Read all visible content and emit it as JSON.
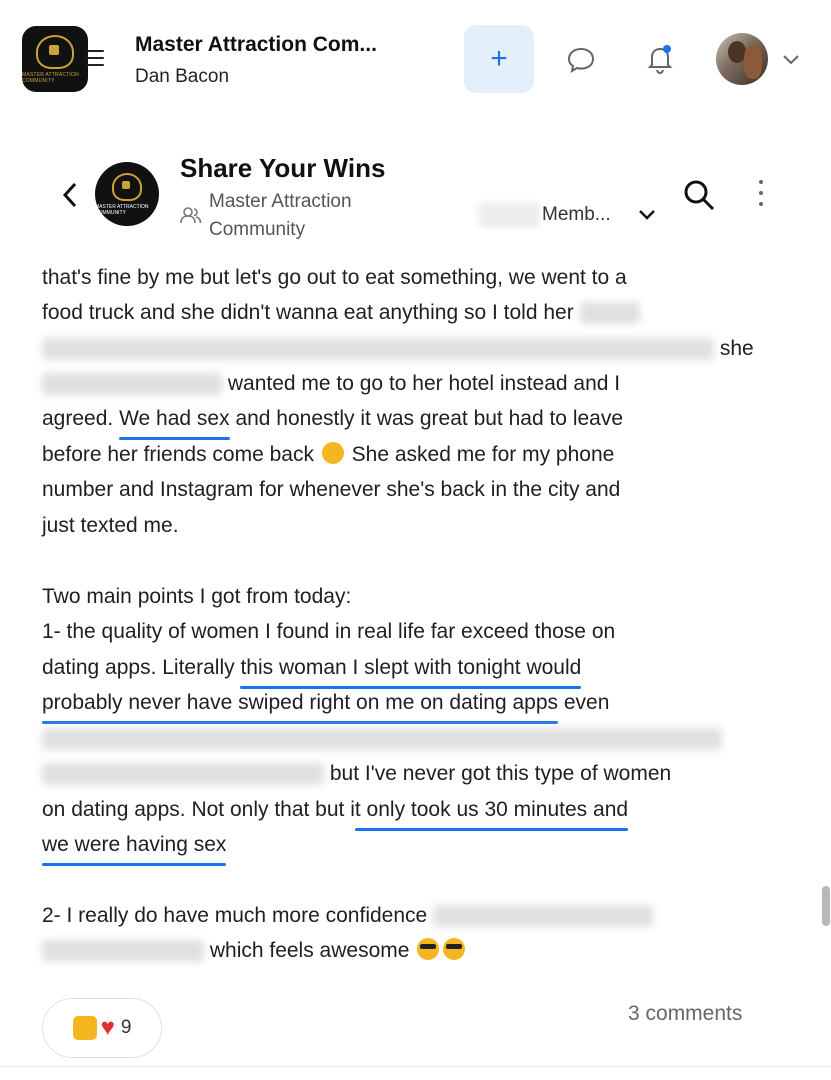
{
  "app": {
    "title": "Master Attraction Com...",
    "subtitle": "Dan Bacon",
    "logo_text": "MASTER ATTRACTION COMMUNITY",
    "plus_label": "+"
  },
  "channel": {
    "title": "Share Your Wins",
    "community": "Master Attraction Community",
    "logo_text": "MASTER ATTRACTION COMMUNITY",
    "members_label": "Memb..."
  },
  "post": {
    "l1": "that's fine by me but let's go out to eat something, we went to a",
    "l2": "food truck and she didn't wanna eat anything so I told her",
    "l3": "she",
    "l4": "wanted me to go to her hotel instead and I",
    "l5a": "agreed.",
    "l5u": "We had sex",
    "l5b": "and honestly it was great but had to leave",
    "l6a": "before her friends come back",
    "l6b": "She asked me for my phone",
    "l7": "number and Instagram for whenever she's back in the city and",
    "l8": "just texted me.",
    "l9": "Two main points I got from today:",
    "l10": "1- the quality of women I found in real life far exceed those on",
    "l11a": "dating apps. Literally",
    "l11u": "this woman I slept with tonight would",
    "l12u": "probably never have swiped right on me on dating apps",
    "l12b": "even",
    "l14": "but I've never got this type of women",
    "l15a": "on dating apps. Not only that but i",
    "l15u": "t only took us 30 minutes and",
    "l16u": "we were having sex",
    "l17": "2- I really do have much more confidence",
    "l18": "which feels awesome"
  },
  "reactions": {
    "count": "9",
    "comments": "3 comments"
  },
  "colors": {
    "accent": "#1a73e8",
    "plus_bg": "#e3f0fb",
    "brand_gold": "#c9a23a"
  },
  "icons": [
    "menu-icon",
    "plus-icon",
    "chat-icon",
    "bell-icon",
    "chevron-down-icon",
    "back-icon",
    "group-icon",
    "search-icon",
    "more-vertical-icon"
  ]
}
